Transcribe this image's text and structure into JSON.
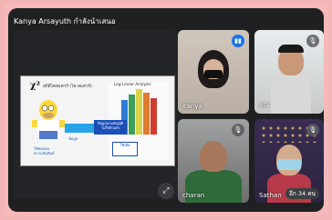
{
  "presenter": {
    "label": "Kanya Arsayuth กำลังนำเสนอ"
  },
  "slide": {
    "symbol": "χ²",
    "heading": "สถิติไคสแควร์ (ไค-สแควร์)",
    "chart_title": "Log-Linear Analysis",
    "callout_main": "ข้อมูลนามบัญญัติ ไม่ใช่ตัวเลข",
    "callout_sub": "ใช้เมื่อ",
    "blue_label": "ข้อมูล",
    "caption_line1": "ใช้ทดสอบ",
    "caption_line2": "ความสัมพันธ์"
  },
  "participants": [
    {
      "name": "Kanya",
      "mic": "speaking"
    },
    {
      "name": "คุณ",
      "mic": "muted"
    },
    {
      "name": "charan",
      "mic": "muted"
    },
    {
      "name": "Sathan",
      "mic": "muted"
    }
  ],
  "more_badge": "อีก 34 คน",
  "icons": {
    "fullscreen": "fullscreen-icon",
    "mic_muted": "mic-off-icon",
    "speaking": "speaking-icon"
  },
  "colors": {
    "speaking": "#1a73e8",
    "background": "#1f2022"
  }
}
